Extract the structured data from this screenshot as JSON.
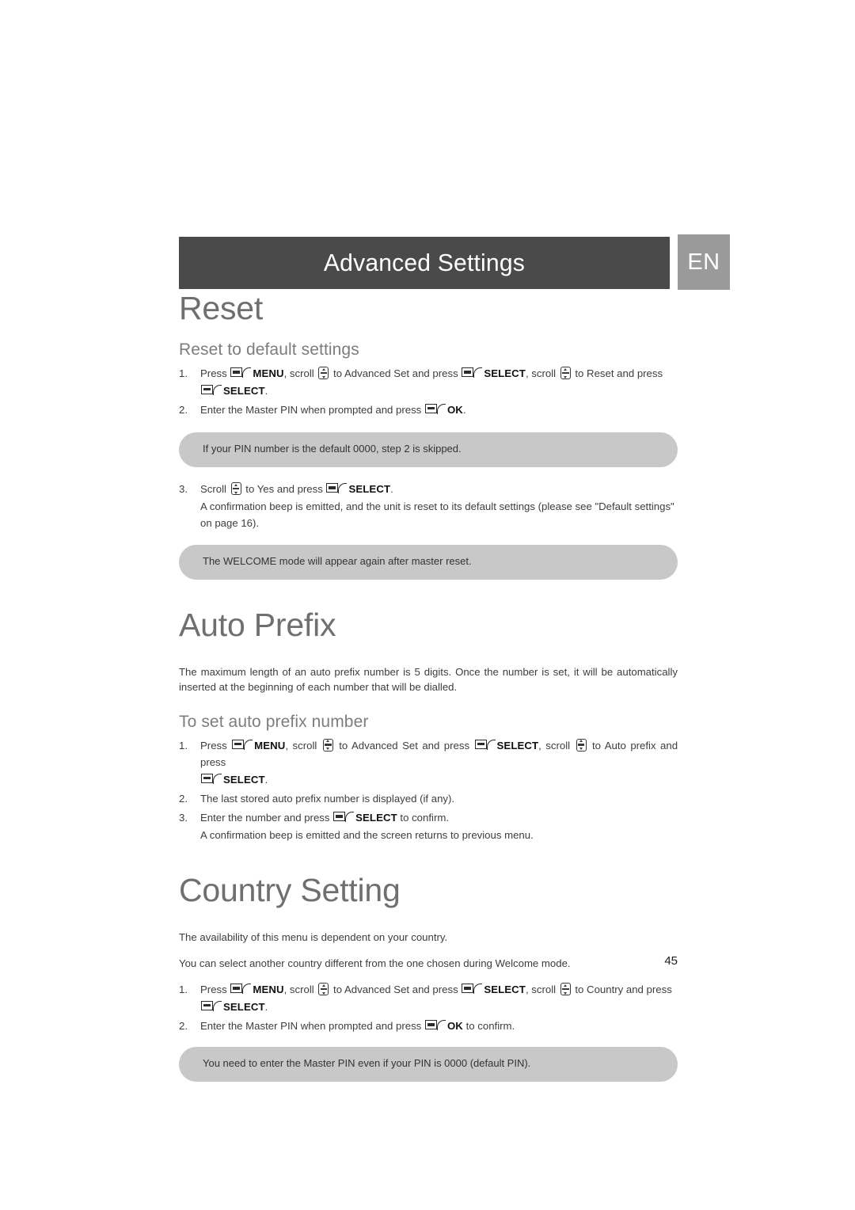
{
  "header": {
    "title": "Advanced Settings",
    "language_badge": "EN"
  },
  "page_number": "45",
  "colors": {
    "header_bar": "#4a4a4a",
    "language_badge": "#9a9a9a",
    "note_box": "#c8c8c8",
    "heading_text": "#6f6f6f",
    "body_text": "#3d3d3d"
  },
  "icons": {
    "softkey": "softkey-icon",
    "scroll": "scroll-up-down-icon"
  },
  "sections": [
    {
      "id": "reset",
      "chapter_title": "Reset",
      "subsection_title": "Reset to default settings",
      "step1": {
        "num": "1.",
        "t1": "Press ",
        "k1": "MENU",
        "t2": ", scroll ",
        "t3": " to Advanced Set and press ",
        "k2": "SELECT",
        "t4": ", scroll ",
        "t5": " to Reset and press",
        "k3": "SELECT",
        "t6": "."
      },
      "step2": {
        "num": "2.",
        "t1": "Enter the Master PIN when prompted and press ",
        "k1": "OK",
        "t2": "."
      },
      "note1": "If your PIN number is the default 0000, step 2 is skipped.",
      "step3": {
        "num": "3.",
        "t1": "Scroll ",
        "t2": " to Yes and press ",
        "k1": "SELECT",
        "t3": ".",
        "sub": "A confirmation beep is emitted, and the unit is reset to its default settings (please see \"Default settings\" on page 16)."
      },
      "note2": "The WELCOME mode will appear again after master reset."
    },
    {
      "id": "auto-prefix",
      "chapter_title": "Auto Prefix",
      "intro": "The maximum length of an auto prefix number is 5 digits. Once the number is set, it will be automatically inserted at the beginning of each number that will be dialled.",
      "subsection_title": "To set auto prefix number",
      "step1": {
        "num": "1.",
        "t1": "Press ",
        "k1": "MENU",
        "t2": ", scroll ",
        "t3": " to Advanced Set and press ",
        "k2": "SELECT",
        "t4": ", scroll ",
        "t5": " to Auto prefix and press",
        "k3": "SELECT",
        "t6": "."
      },
      "step2": {
        "num": "2.",
        "t1": "The last stored auto prefix number is displayed (if any)."
      },
      "step3": {
        "num": "3.",
        "t1": "Enter the number and press ",
        "k1": "SELECT",
        "t2": " to confirm.",
        "sub": "A confirmation beep is emitted and the screen returns to previous menu."
      }
    },
    {
      "id": "country-setting",
      "chapter_title": "Country Setting",
      "intro1": "The availability of this menu is dependent on your country.",
      "intro2": "You can select another country different from the one chosen during Welcome mode.",
      "step1": {
        "num": "1.",
        "t1": "Press ",
        "k1": "MENU",
        "t2": ", scroll ",
        "t3": " to Advanced Set and press ",
        "k2": "SELECT",
        "t4": ", scroll ",
        "t5": " to Country and press",
        "k3": "SELECT",
        "t6": "."
      },
      "step2": {
        "num": "2.",
        "t1": "Enter the Master PIN when prompted and press ",
        "k1": "OK",
        "t2": " to confirm."
      },
      "note1": "You need to enter the Master PIN even if your PIN is 0000 (default PIN)."
    }
  ]
}
